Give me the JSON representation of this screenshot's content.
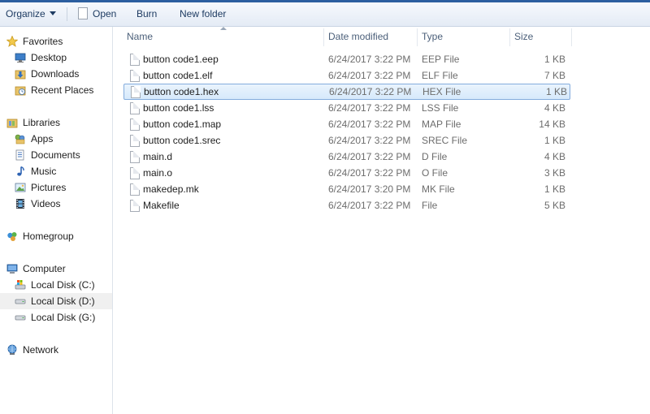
{
  "toolbar": {
    "organize": "Organize",
    "open": "Open",
    "burn": "Burn",
    "new_folder": "New folder"
  },
  "nav": {
    "favorites": {
      "label": "Favorites",
      "icon": "star-icon"
    },
    "favorites_items": [
      {
        "label": "Desktop",
        "icon": "desktop-icon"
      },
      {
        "label": "Downloads",
        "icon": "downloads-folder-icon"
      },
      {
        "label": "Recent Places",
        "icon": "recent-places-icon"
      }
    ],
    "libraries": {
      "label": "Libraries",
      "icon": "libraries-folder-icon"
    },
    "libraries_items": [
      {
        "label": "Apps",
        "icon": "apps-icon"
      },
      {
        "label": "Documents",
        "icon": "documents-icon"
      },
      {
        "label": "Music",
        "icon": "music-note-icon"
      },
      {
        "label": "Pictures",
        "icon": "pictures-icon"
      },
      {
        "label": "Videos",
        "icon": "video-film-icon"
      }
    ],
    "homegroup": {
      "label": "Homegroup",
      "icon": "homegroup-icon"
    },
    "computer": {
      "label": "Computer",
      "icon": "computer-icon"
    },
    "computer_items": [
      {
        "label": "Local Disk (C:)",
        "icon": "system-disk-icon"
      },
      {
        "label": "Local Disk (D:)",
        "icon": "hard-disk-icon",
        "selected": true
      },
      {
        "label": "Local Disk (G:)",
        "icon": "hard-disk-icon"
      }
    ],
    "network": {
      "label": "Network",
      "icon": "network-icon"
    }
  },
  "columns": {
    "name": "Name",
    "date": "Date modified",
    "type": "Type",
    "size": "Size"
  },
  "files": [
    {
      "name": "button code1.eep",
      "date": "6/24/2017 3:22 PM",
      "type": "EEP File",
      "size": "1 KB"
    },
    {
      "name": "button code1.elf",
      "date": "6/24/2017 3:22 PM",
      "type": "ELF File",
      "size": "7 KB"
    },
    {
      "name": "button code1.hex",
      "date": "6/24/2017 3:22 PM",
      "type": "HEX File",
      "size": "1 KB",
      "selected": true
    },
    {
      "name": "button code1.lss",
      "date": "6/24/2017 3:22 PM",
      "type": "LSS File",
      "size": "4 KB"
    },
    {
      "name": "button code1.map",
      "date": "6/24/2017 3:22 PM",
      "type": "MAP File",
      "size": "14 KB"
    },
    {
      "name": "button code1.srec",
      "date": "6/24/2017 3:22 PM",
      "type": "SREC File",
      "size": "1 KB"
    },
    {
      "name": "main.d",
      "date": "6/24/2017 3:22 PM",
      "type": "D File",
      "size": "4 KB"
    },
    {
      "name": "main.o",
      "date": "6/24/2017 3:22 PM",
      "type": "O File",
      "size": "3 KB"
    },
    {
      "name": "makedep.mk",
      "date": "6/24/2017 3:20 PM",
      "type": "MK File",
      "size": "1 KB"
    },
    {
      "name": "Makefile",
      "date": "6/24/2017 3:22 PM",
      "type": "File",
      "size": "5 KB"
    }
  ],
  "colors": {
    "accent": "#2c5fa0",
    "selection_border": "#84acdd",
    "selection_fill": "#d6e9fb"
  }
}
